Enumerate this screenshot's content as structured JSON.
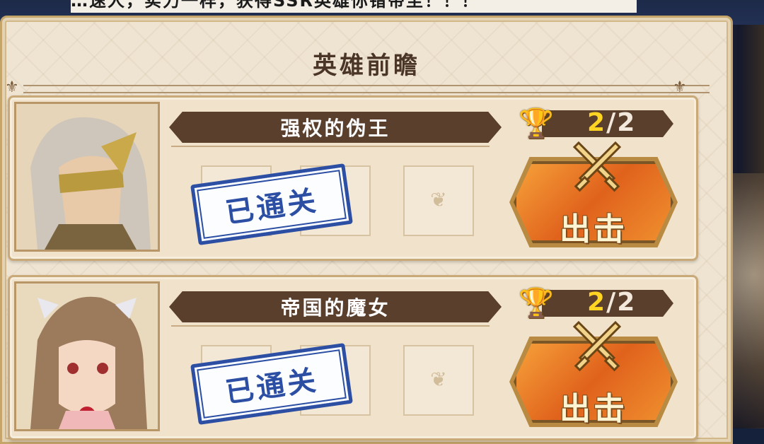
{
  "top_ticker": "…速人，实力一样，获得SSR英雄你错带至！！！",
  "panel": {
    "title": "英雄前瞻"
  },
  "heroes": [
    {
      "name": "强权的伪王",
      "status": "已通关",
      "score_current": "2",
      "score_sep": "/",
      "score_total": "2",
      "attack_label": "出击",
      "portrait_icon": "masked-king-portrait"
    },
    {
      "name": "帝国的魔女",
      "status": "已通关",
      "score_current": "2",
      "score_sep": "/",
      "score_total": "2",
      "attack_label": "出击",
      "portrait_icon": "witch-portrait"
    }
  ],
  "colors": {
    "banner": "#5a3f2d",
    "stamp": "#2c4fa4",
    "score_highlight": "#ffd423",
    "attack_button": "#e0621c"
  }
}
